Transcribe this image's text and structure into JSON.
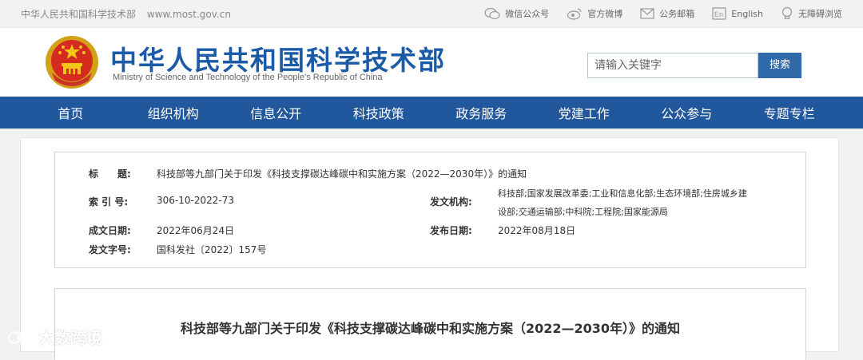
{
  "topbar": {
    "site_name": "中华人民共和国科学技术部",
    "site_url": "www.most.gov.cn",
    "links": [
      {
        "label": "微信公众号",
        "icon": "wechat-icon"
      },
      {
        "label": "官方微博",
        "icon": "weibo-icon"
      },
      {
        "label": "公务邮箱",
        "icon": "mail-icon"
      },
      {
        "label": "English",
        "icon": "english-icon"
      },
      {
        "label": "无障碍浏览",
        "icon": "accessibility-icon"
      }
    ],
    "english_badge": "En"
  },
  "header": {
    "title": "中华人民共和国科学技术部",
    "subtitle": "Ministry of Science and Technology of the People's Republic of China",
    "search_placeholder": "请输入关键字",
    "search_button": "搜索"
  },
  "nav": {
    "items": [
      "首页",
      "组织机构",
      "信息公开",
      "科技政策",
      "政务服务",
      "党建工作",
      "公众参与",
      "专题专栏"
    ]
  },
  "meta": {
    "title_label": "标　　题:",
    "title_value": "科技部等九部门关于印发《科技支撑碳达峰碳中和实施方案（2022—2030年）》的通知",
    "index_label": "索 引 号:",
    "index_value": "306-10-2022-73",
    "issuer_label": "发文机构:",
    "issuer_line1": "科技部;国家发展改革委;工业和信息化部;生态环境部;住房城乡建",
    "issuer_line2": "设部;交通运输部;中科院;工程院;国家能源局",
    "written_label": "成文日期:",
    "written_value": "2022年06月24日",
    "published_label": "发布日期:",
    "published_value": "2022年08月18日",
    "doc_no_label": "发文字号:",
    "doc_no_value": "国科发社〔2022〕157号"
  },
  "article": {
    "title": "科技部等九部门关于印发《科技支撑碳达峰碳中和实施方案（2022—2030年）》的通知"
  },
  "watermark": {
    "text": "大数跨境"
  },
  "colors": {
    "nav_bg": "#21579c",
    "title_blue": "#1a5aa6",
    "search_btn": "#3269a8"
  }
}
